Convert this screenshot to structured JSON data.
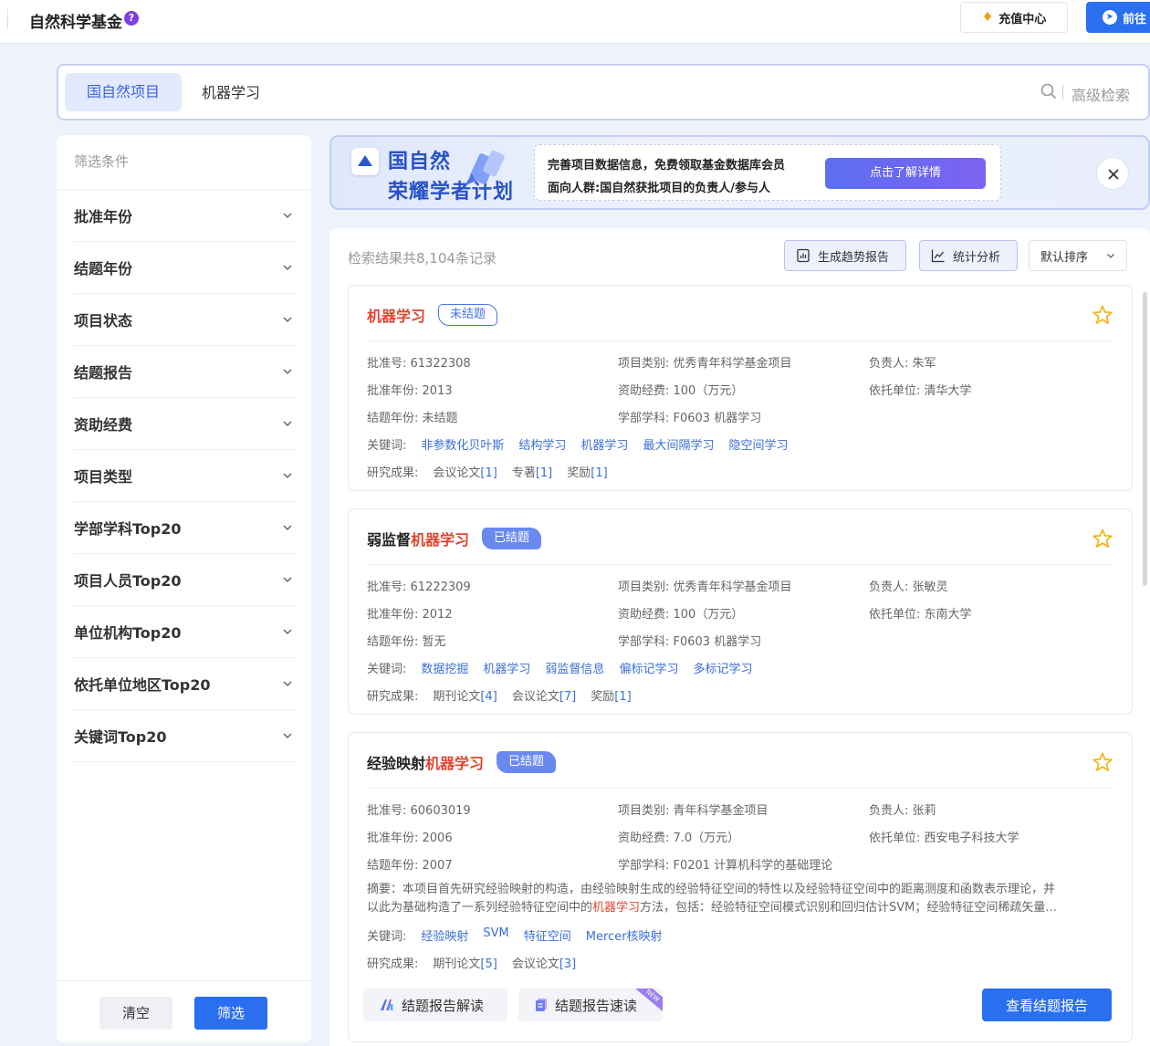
{
  "header": {
    "title": "自然科学基金",
    "help_glyph": "?",
    "recharge_label": "充值中心",
    "goto_label": "前往"
  },
  "search": {
    "scope_label": "国自然项目",
    "query": "机器学习",
    "advanced_label": "高级检索"
  },
  "sidebar": {
    "header": "筛选条件",
    "filters": [
      {
        "label": "批准年份"
      },
      {
        "label": "结题年份"
      },
      {
        "label": "项目状态"
      },
      {
        "label": "结题报告"
      },
      {
        "label": "资助经费"
      },
      {
        "label": "项目类型"
      },
      {
        "label": "学部学科Top20"
      },
      {
        "label": "项目人员Top20"
      },
      {
        "label": "单位机构Top20"
      },
      {
        "label": "依托单位地区Top20"
      },
      {
        "label": "关键词Top20"
      }
    ],
    "clear_label": "清空",
    "filter_label": "筛选"
  },
  "banner": {
    "line1": "国自然",
    "line2": "荣耀学者计划",
    "info1": "完善项目数据信息，免费领取基金数据库会员",
    "info2": "面向人群:国自然获批项目的负责人/参与人",
    "cta": "点击了解详情"
  },
  "results": {
    "count_text": "检索结果共8,104条记录",
    "trend_label": "生成趋势报告",
    "stat_label": "统计分析",
    "sort_label": "默认排序",
    "cards": [
      {
        "title_prefix": "",
        "title_highlight": "机器学习",
        "badge": "未结题",
        "approval_no": "批准号: 61322308",
        "category": "项目类别: 优秀青年科学基金项目",
        "leader": "负责人: 朱军",
        "approval_year": "批准年份: 2013",
        "funding": "资助经费: 100（万元）",
        "institution": "依托单位: 清华大学",
        "conclusion_year": "结题年份: 未结题",
        "discipline": "学部学科: F0603 机器学习",
        "keywords_label": "关键词:",
        "keywords": [
          "非参数化贝叶斯",
          "结构学习",
          "机器学习",
          "最大间隔学习",
          "隐空间学习"
        ],
        "results_label": "研究成果:",
        "outputs": [
          {
            "name": "会议论文",
            "count": "[1]"
          },
          {
            "name": "专著",
            "count": "[1]"
          },
          {
            "name": "奖励",
            "count": "[1]"
          }
        ]
      },
      {
        "title_prefix": "弱监督",
        "title_highlight": "机器学习",
        "badge": "已结题",
        "approval_no": "批准号: 61222309",
        "category": "项目类别: 优秀青年科学基金项目",
        "leader": "负责人: 张敏灵",
        "approval_year": "批准年份: 2012",
        "funding": "资助经费: 100（万元）",
        "institution": "依托单位: 东南大学",
        "conclusion_year": "结题年份: 暂无",
        "discipline": "学部学科: F0603 机器学习",
        "keywords_label": "关键词:",
        "keywords": [
          "数据挖掘",
          "机器学习",
          "弱监督信息",
          "偏标记学习",
          "多标记学习"
        ],
        "results_label": "研究成果:",
        "outputs": [
          {
            "name": "期刊论文",
            "count": "[4]"
          },
          {
            "name": "会议论文",
            "count": "[7]"
          },
          {
            "name": "奖励",
            "count": "[1]"
          }
        ]
      },
      {
        "title_prefix": "经验映射",
        "title_highlight": "机器学习",
        "badge": "已结题",
        "approval_no": "批准号: 60603019",
        "category": "项目类别: 青年科学基金项目",
        "leader": "负责人: 张莉",
        "approval_year": "批准年份: 2006",
        "funding": "资助经费: 7.0（万元）",
        "institution": "依托单位: 西安电子科技大学",
        "conclusion_year": "结题年份: 2007",
        "discipline": "学部学科: F0201 计算机科学的基础理论",
        "abstract_line1": "摘要：本项目首先研究经验映射的构造，由经验映射生成的经验特征空间的特性以及经验特征空间中的距离测度和函数表示理论，并",
        "abstract_line2a": "以此为基础构造了一系列经验特征空间中的",
        "abstract_line2_hl": "机器学习",
        "abstract_line2b": "方法，包括：经验特征空间模式识别和回归估计SVM；经验特征空间稀疏矢量...",
        "keywords_label": "关键词:",
        "keywords": [
          "经验映射",
          "SVM",
          "特征空间",
          "Mercer核映射"
        ],
        "results_label": "研究成果:",
        "outputs": [
          {
            "name": "期刊论文",
            "count": "[5]"
          },
          {
            "name": "会议论文",
            "count": "[3]"
          }
        ],
        "action_interpret": "结题报告解读",
        "action_quickread": "结题报告速读",
        "ribbon": "NEW",
        "action_view": "查看结题报告"
      }
    ]
  },
  "colors": {
    "primary": "#2a6ff0",
    "highlight": "#e0452f",
    "link": "#3a6fd6",
    "badge_done": "#6a89f0",
    "star": "#f2b619"
  }
}
